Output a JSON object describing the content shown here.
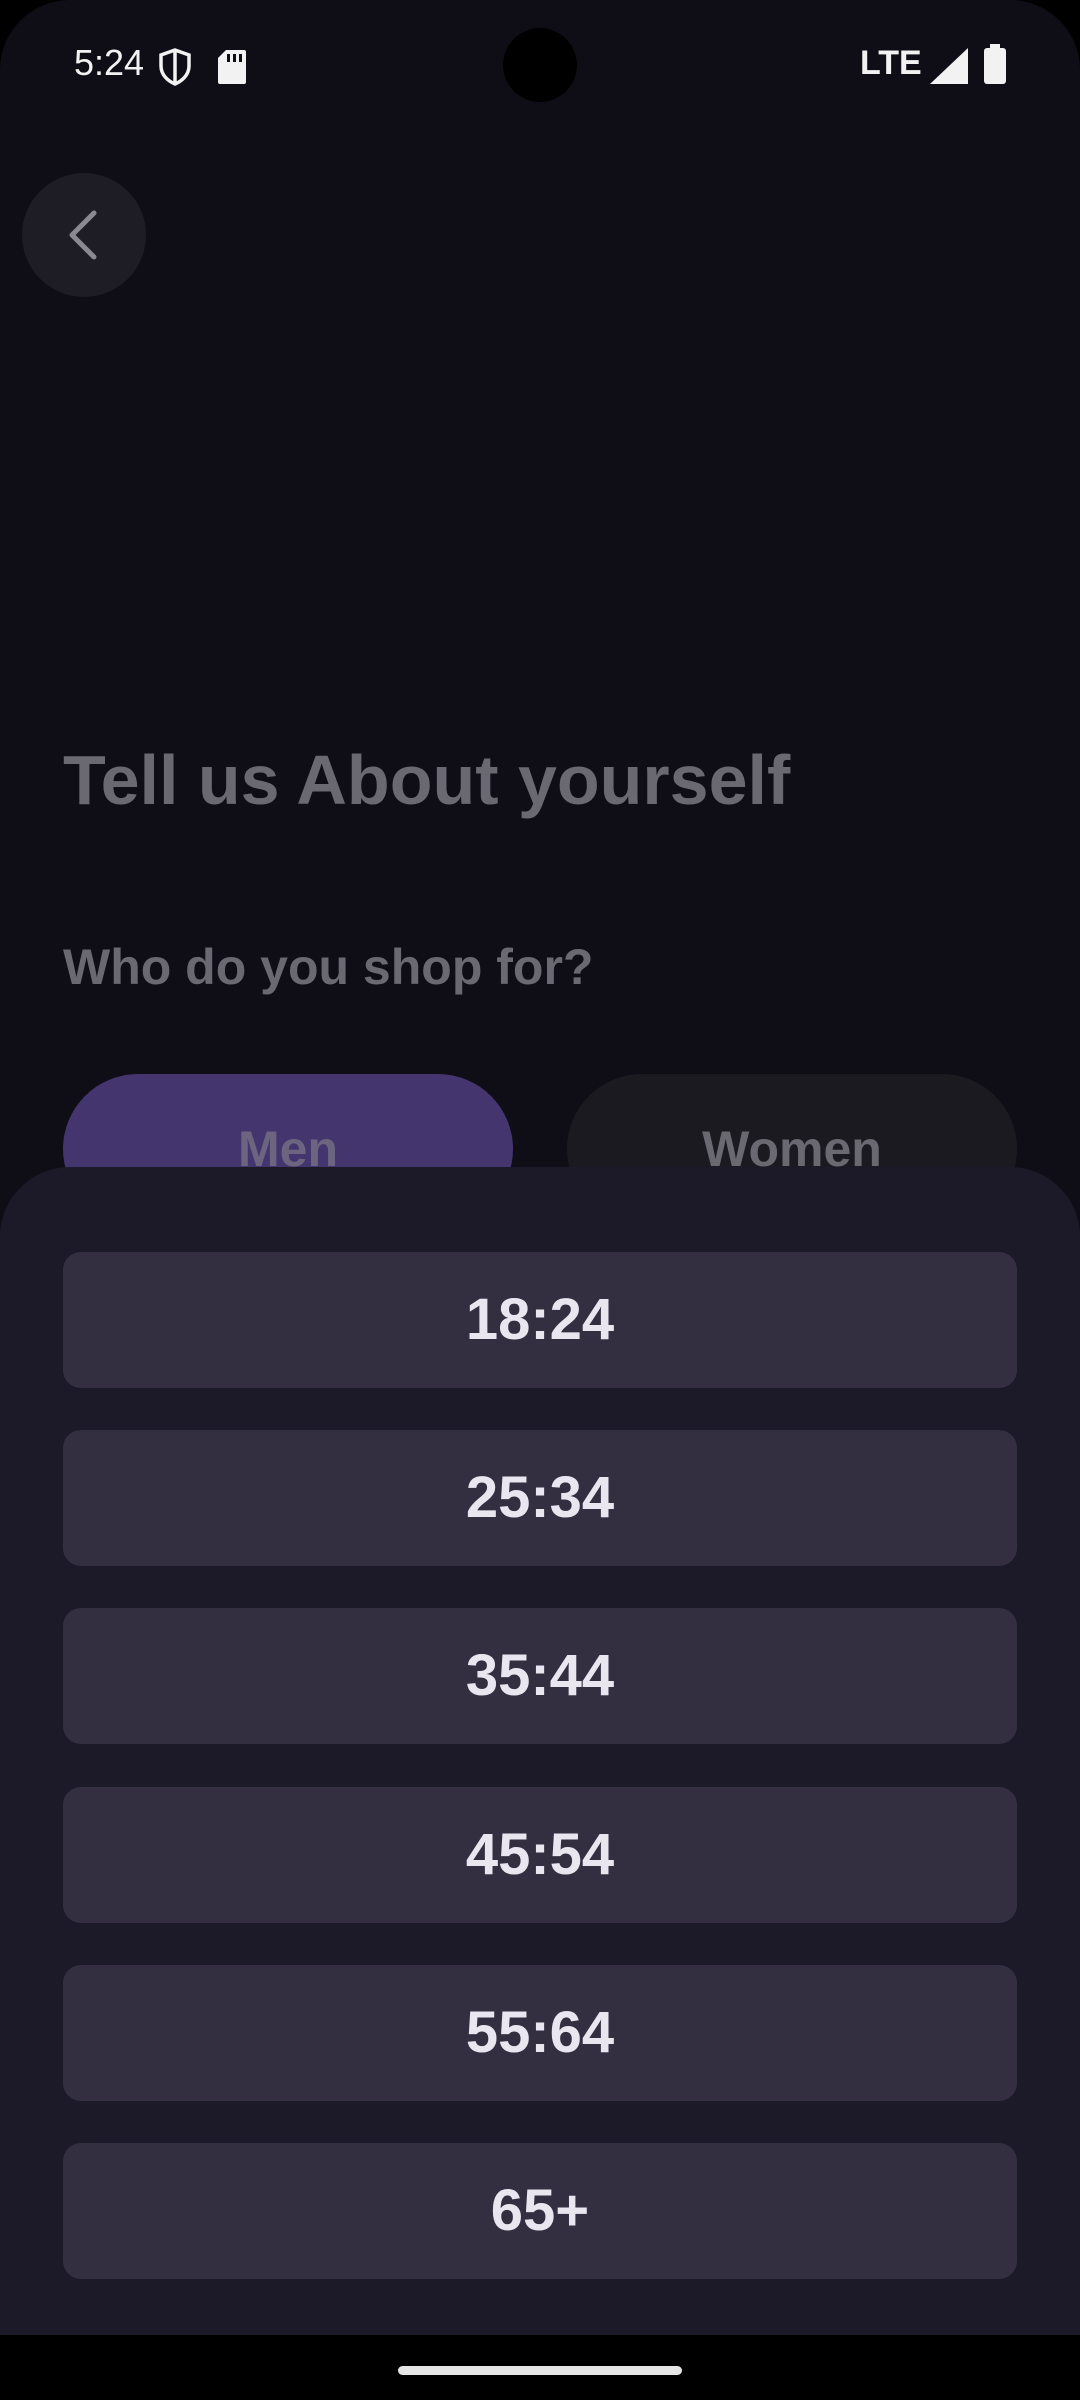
{
  "status_bar": {
    "time": "5:24",
    "network": "LTE",
    "icons": [
      "shield-icon",
      "sd-card-icon",
      "signal-icon",
      "battery-icon"
    ]
  },
  "header": {
    "back_icon": "chevron-left-icon"
  },
  "main": {
    "title": "Tell us About yourself",
    "question": "Who do you shop for?",
    "options": [
      {
        "label": "Men",
        "selected": true
      },
      {
        "label": "Women",
        "selected": false
      }
    ]
  },
  "age_sheet": {
    "options": [
      "18:24",
      "25:34",
      "35:44",
      "45:54",
      "55:64",
      "65+"
    ]
  },
  "colors": {
    "background": "#0f0e17",
    "sheet": "#1c1a29",
    "option": "#332f40",
    "accent": "#45356f"
  }
}
